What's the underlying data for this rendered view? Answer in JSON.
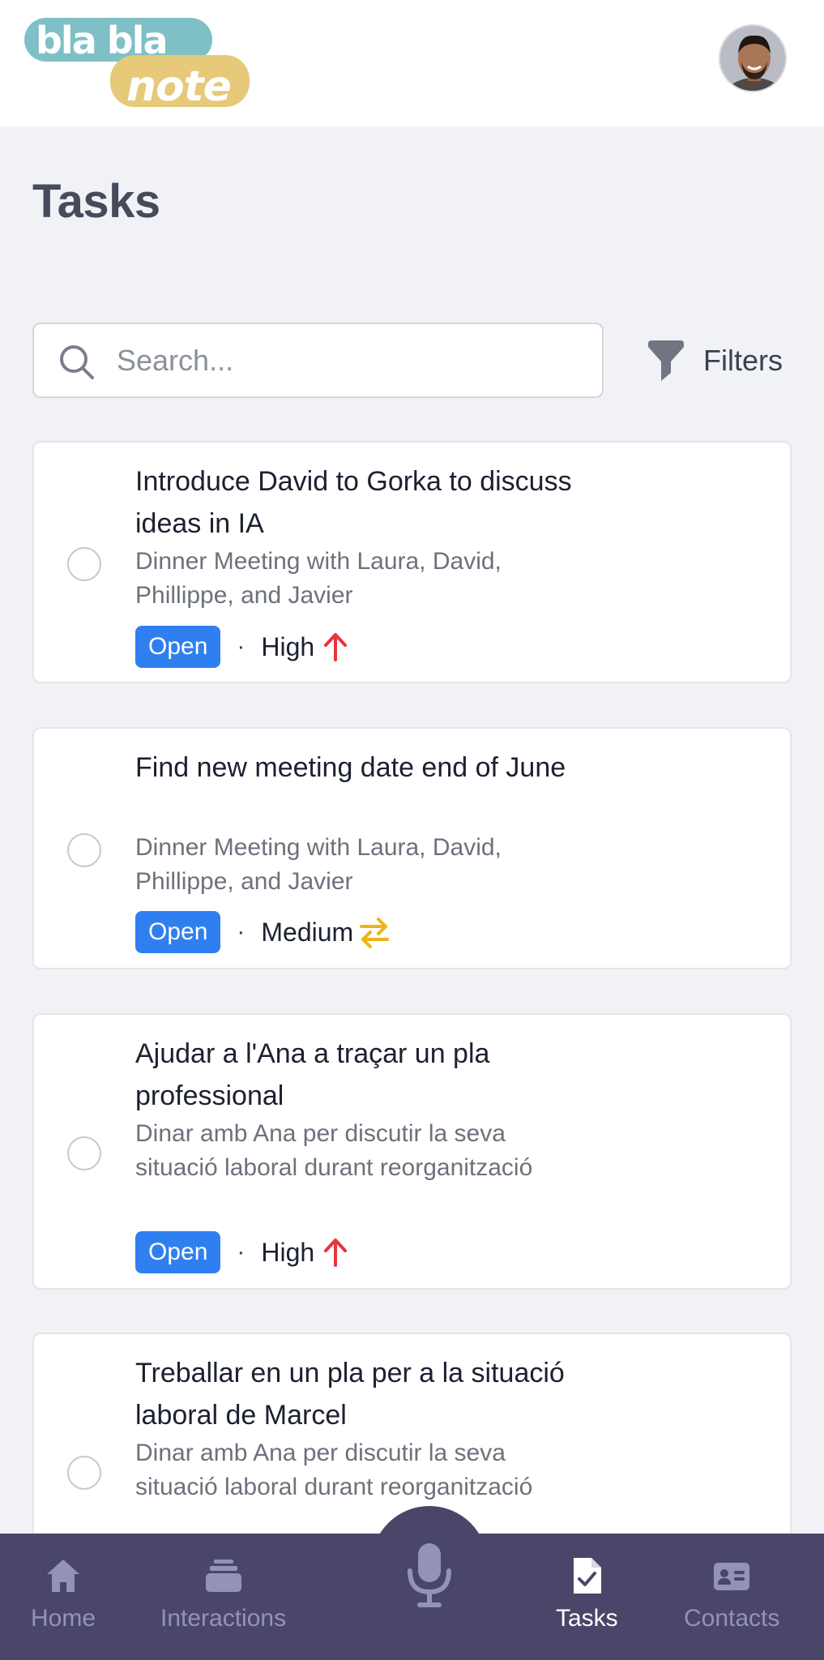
{
  "header": {
    "logo_text_top": "bla bla",
    "logo_text_bottom": "note",
    "avatar_alt": "User avatar"
  },
  "page": {
    "title": "Tasks"
  },
  "search": {
    "placeholder": "Search...",
    "value": ""
  },
  "filters": {
    "label": "Filters"
  },
  "tasks": [
    {
      "title": "Introduce David to Gorka to discuss ideas in IA",
      "subtitle": "Dinner Meeting with Laura, David, Phillippe, and Javier",
      "status": "Open",
      "priority": "High",
      "priority_icon": "arrow-up-icon"
    },
    {
      "title": "Find new meeting date end of June",
      "subtitle": "Dinner Meeting with Laura, David, Phillippe, and Javier",
      "status": "Open",
      "priority": "Medium",
      "priority_icon": "arrows-swap-icon"
    },
    {
      "title": "Ajudar a l'Ana a traçar un pla professional",
      "subtitle": "Dinar amb Ana per discutir la seva situació laboral durant reorganització",
      "status": "Open",
      "priority": "High",
      "priority_icon": "arrow-up-icon"
    },
    {
      "title": "Treballar en un pla per a la situació laboral de Marcel",
      "subtitle": "Dinar amb Ana per discutir la seva situació laboral durant reorganització",
      "status": "",
      "priority": "",
      "priority_icon": ""
    }
  ],
  "bottom_nav": {
    "home": "Home",
    "interactions": "Interactions",
    "tasks": "Tasks",
    "contacts": "Contacts"
  },
  "colors": {
    "accent_blue": "#2f7ff0",
    "nav_background": "#4a4669",
    "high_priority": "#e8343c",
    "medium_priority": "#f0b21a",
    "logo_teal": "#7fbfc6",
    "logo_yellow": "#e6c979"
  }
}
